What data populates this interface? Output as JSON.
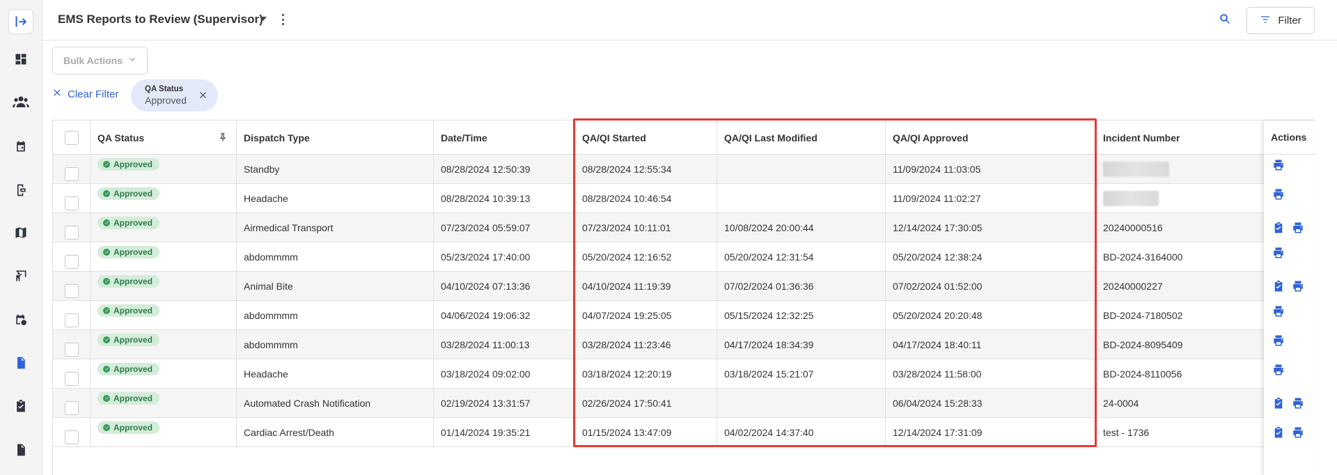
{
  "header": {
    "title": "EMS Reports to Review (Supervisor)",
    "filter_label": "Filter"
  },
  "toolbar": {
    "bulk_actions_label": "Bulk Actions",
    "clear_filter_label": "Clear Filter",
    "chip": {
      "label": "QA Status",
      "value": "Approved"
    }
  },
  "sidebar": {
    "items": [
      {
        "icon": "collapse-sidebar-icon"
      },
      {
        "icon": "dashboard-icon"
      },
      {
        "icon": "people-icon"
      },
      {
        "icon": "calendar-icon"
      },
      {
        "icon": "device-icon"
      },
      {
        "icon": "map-icon"
      },
      {
        "icon": "presentation-icon"
      },
      {
        "icon": "calendar-clock-icon"
      },
      {
        "icon": "report-document-icon"
      },
      {
        "icon": "clipboard-check-icon"
      },
      {
        "icon": "document-edit-icon"
      }
    ],
    "active_index": 8
  },
  "table": {
    "columns": [
      "QA Status",
      "Dispatch Type",
      "Date/Time",
      "QA/QI Started",
      "QA/QI Last Modified",
      "QA/QI Approved",
      "Incident Number",
      "Actions"
    ],
    "rows": [
      {
        "status": "Approved",
        "dispatch": "Standby",
        "datetime": "08/28/2024 12:50:39",
        "started": "08/28/2024 12:55:34",
        "modified": "",
        "approved": "11/09/2024 11:03:05",
        "incident": "",
        "actions": [
          "print"
        ]
      },
      {
        "status": "Approved",
        "dispatch": "Headache",
        "datetime": "08/28/2024 10:39:13",
        "started": "08/28/2024 10:46:54",
        "modified": "",
        "approved": "11/09/2024 11:02:27",
        "incident": "",
        "actions": [
          "print"
        ]
      },
      {
        "status": "Approved",
        "dispatch": "Airmedical Transport",
        "datetime": "07/23/2024 05:59:07",
        "started": "07/23/2024 10:11:01",
        "modified": "10/08/2024 20:00:44",
        "approved": "12/14/2024 17:30:05",
        "incident": "20240000516",
        "actions": [
          "review",
          "print"
        ]
      },
      {
        "status": "Approved",
        "dispatch": "abdommmm",
        "datetime": "05/23/2024 17:40:00",
        "started": "05/20/2024 12:16:52",
        "modified": "05/20/2024 12:31:54",
        "approved": "05/20/2024 12:38:24",
        "incident": "BD-2024-3164000",
        "actions": [
          "print"
        ]
      },
      {
        "status": "Approved",
        "dispatch": "Animal Bite",
        "datetime": "04/10/2024 07:13:36",
        "started": "04/10/2024 11:19:39",
        "modified": "07/02/2024 01:36:36",
        "approved": "07/02/2024 01:52:00",
        "incident": "20240000227",
        "actions": [
          "review",
          "print"
        ]
      },
      {
        "status": "Approved",
        "dispatch": "abdommmm",
        "datetime": "04/06/2024 19:06:32",
        "started": "04/07/2024 19:25:05",
        "modified": "05/15/2024 12:32:25",
        "approved": "05/20/2024 20:20:48",
        "incident": "BD-2024-7180502",
        "actions": [
          "print"
        ]
      },
      {
        "status": "Approved",
        "dispatch": "abdommmm",
        "datetime": "03/28/2024 11:00:13",
        "started": "03/28/2024 11:23:46",
        "modified": "04/17/2024 18:34:39",
        "approved": "04/17/2024 18:40:11",
        "incident": "BD-2024-8095409",
        "actions": [
          "print"
        ]
      },
      {
        "status": "Approved",
        "dispatch": "Headache",
        "datetime": "03/18/2024 09:02:00",
        "started": "03/18/2024 12:20:19",
        "modified": "03/18/2024 15:21:07",
        "approved": "03/28/2024 11:58:00",
        "incident": "BD-2024-8110056",
        "actions": [
          "print"
        ]
      },
      {
        "status": "Approved",
        "dispatch": "Automated Crash Notification",
        "datetime": "02/19/2024 13:31:57",
        "started": "02/26/2024 17:50:41",
        "modified": "",
        "approved": "06/04/2024 15:28:33",
        "incident": "24-0004",
        "actions": [
          "review",
          "print"
        ]
      },
      {
        "status": "Approved",
        "dispatch": "Cardiac Arrest/Death",
        "datetime": "01/14/2024 19:35:21",
        "started": "01/15/2024 13:47:09",
        "modified": "04/02/2024 14:37:40",
        "approved": "12/14/2024 17:31:09",
        "incident": "test - 1736",
        "actions": [
          "review",
          "print"
        ]
      }
    ]
  },
  "colors": {
    "accent": "#2f62d9",
    "approved_bg": "#d4ecda",
    "approved_text": "#2e7d4a",
    "highlight": "#e53935"
  }
}
